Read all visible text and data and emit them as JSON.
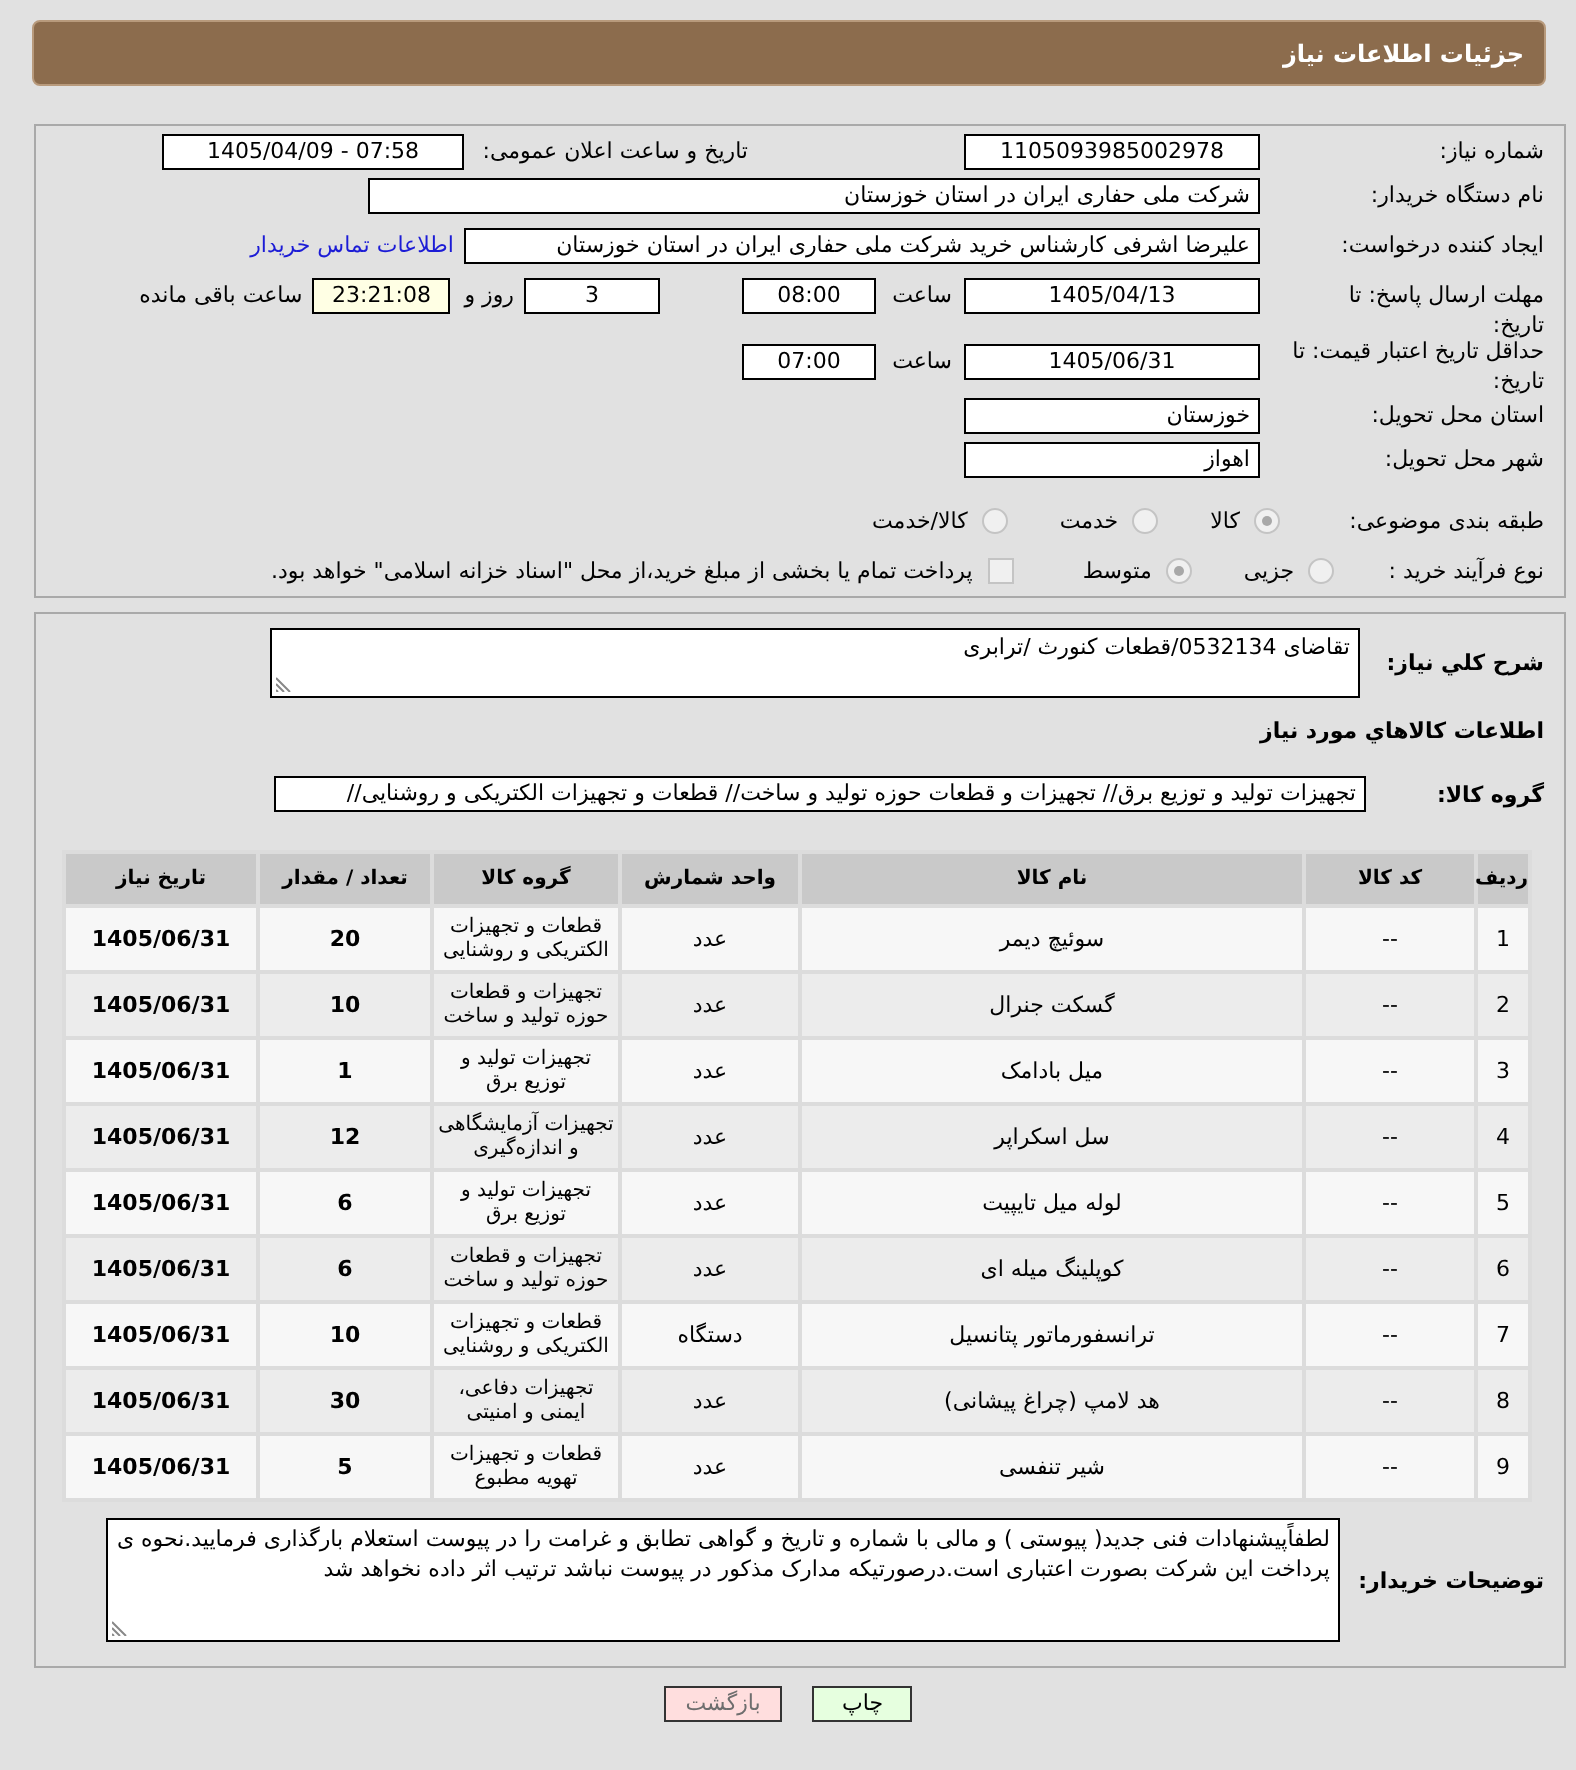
{
  "header": {
    "title": "جزئیات اطلاعات نیاز"
  },
  "details": {
    "need_number": {
      "label": "شماره نیاز:",
      "value": "1105093985002978"
    },
    "announcement": {
      "label": "تاریخ و ساعت اعلان عمومی:",
      "value": "1405/04/09 - 07:58"
    },
    "buyer_org": {
      "label": "نام دستگاه خریدار:",
      "value": "شرکت ملی حفاری ایران در استان خوزستان"
    },
    "requester": {
      "label": "ایجاد کننده درخواست:",
      "value": "علیرضا اشرفی کارشناس خرید شرکت ملی حفاری ایران در استان خوزستان",
      "link": "اطلاعات تماس خریدار"
    },
    "response_deadline": {
      "label": "مهلت ارسال پاسخ: تا تاریخ:",
      "date": "1405/04/13",
      "time_label": "ساعت",
      "time": "08:00",
      "days": "3",
      "days_label": "روز و",
      "remaining": "23:21:08",
      "remaining_label": "ساعت باقی مانده"
    },
    "price_validity": {
      "label": "حداقل تاریخ اعتبار قیمت: تا تاریخ:",
      "date": "1405/06/31",
      "time_label": "ساعت",
      "time": "07:00"
    },
    "delivery_province": {
      "label": "استان محل تحویل:",
      "value": "خوزستان"
    },
    "delivery_city": {
      "label": "شهر محل تحویل:",
      "value": "اهواز"
    },
    "subject_category": {
      "label": "طبقه بندی موضوعی:",
      "options": [
        {
          "label": "کالا",
          "selected": true,
          "disabled": true
        },
        {
          "label": "خدمت",
          "selected": false,
          "disabled": true
        },
        {
          "label": "کالا/خدمت",
          "selected": false,
          "disabled": true
        }
      ]
    },
    "purchase_process": {
      "label": "نوع فرآیند خرید :",
      "options": [
        {
          "label": "جزیی",
          "selected": false,
          "disabled": true
        },
        {
          "label": "متوسط",
          "selected": true,
          "disabled": true
        }
      ],
      "treasury_payment": {
        "label": "پرداخت تمام یا بخشی از مبلغ خرید،از محل \"اسناد خزانه اسلامی\" خواهد بود.",
        "checked": false,
        "disabled": true
      }
    }
  },
  "needs": {
    "summary": {
      "label": "شرح کلي نياز:",
      "value": "تقاضای 0532134/قطعات کنورث /ترابری"
    },
    "goods_heading": "اطلاعات كالاهاي مورد نياز",
    "goods_group": {
      "label": "گروه کالا:",
      "value": "تجهیزات تولید و توزیع برق// تجهیزات و قطعات حوزه تولید و ساخت// قطعات و تجهیزات الکتریکی و روشنایی//"
    },
    "table": {
      "columns": [
        "ردیف",
        "کد کالا",
        "نام کالا",
        "واحد شمارش",
        "گروه کالا",
        "تعداد / مقدار",
        "تاریخ نیاز"
      ],
      "rows": [
        {
          "index": "1",
          "code": "--",
          "name": "سوئیچ دیمر",
          "unit": "عدد",
          "group": "قطعات و تجهیزات الکتریکی و روشنایی",
          "quantity": "20",
          "date": "1405/06/31"
        },
        {
          "index": "2",
          "code": "--",
          "name": "گسکت جنرال",
          "unit": "عدد",
          "group": "تجهیزات و قطعات حوزه تولید و ساخت",
          "quantity": "10",
          "date": "1405/06/31"
        },
        {
          "index": "3",
          "code": "--",
          "name": "میل بادامک",
          "unit": "عدد",
          "group": "تجهیزات تولید و توزیع برق",
          "quantity": "1",
          "date": "1405/06/31"
        },
        {
          "index": "4",
          "code": "--",
          "name": "سل اسکراپر",
          "unit": "عدد",
          "group": "تجهیزات آزمایشگاهی و اندازه‌گیری",
          "quantity": "12",
          "date": "1405/06/31"
        },
        {
          "index": "5",
          "code": "--",
          "name": "لوله میل تایپیت",
          "unit": "عدد",
          "group": "تجهیزات تولید و توزیع برق",
          "quantity": "6",
          "date": "1405/06/31"
        },
        {
          "index": "6",
          "code": "--",
          "name": "کوپلینگ میله ای",
          "unit": "عدد",
          "group": "تجهیزات و قطعات حوزه تولید و ساخت",
          "quantity": "6",
          "date": "1405/06/31"
        },
        {
          "index": "7",
          "code": "--",
          "name": "ترانسفورماتور پتانسیل",
          "unit": "دستگاه",
          "group": "قطعات و تجهیزات الکتریکی و روشنایی",
          "quantity": "10",
          "date": "1405/06/31"
        },
        {
          "index": "8",
          "code": "--",
          "name": "هد لامپ (چراغ پیشانی)",
          "unit": "عدد",
          "group": "تجهیزات دفاعی، ایمنی و امنیتی",
          "quantity": "30",
          "date": "1405/06/31"
        },
        {
          "index": "9",
          "code": "--",
          "name": "شیر تنفسی",
          "unit": "عدد",
          "group": "قطعات و تجهیزات تهویه مطبوع",
          "quantity": "5",
          "date": "1405/06/31"
        }
      ]
    },
    "buyer_notes": {
      "label": "توضیحات خریدار:",
      "value": "لطفاًپیشنهادات فنی جدید( پیوستی ) و مالی با شماره و تاریخ و گواهی تطابق و غرامت را در پیوست استعلام بارگذاری فرمایید.نحوه ی پرداخت این شرکت بصورت اعتباری است.درصورتیکه مدارک مذکور در پیوست نباشد ترتیب اثر داده نخواهد شد"
    }
  },
  "buttons": [
    {
      "label": "چاپ",
      "kind": "print"
    },
    {
      "label": "بازگشت",
      "kind": "back"
    }
  ]
}
